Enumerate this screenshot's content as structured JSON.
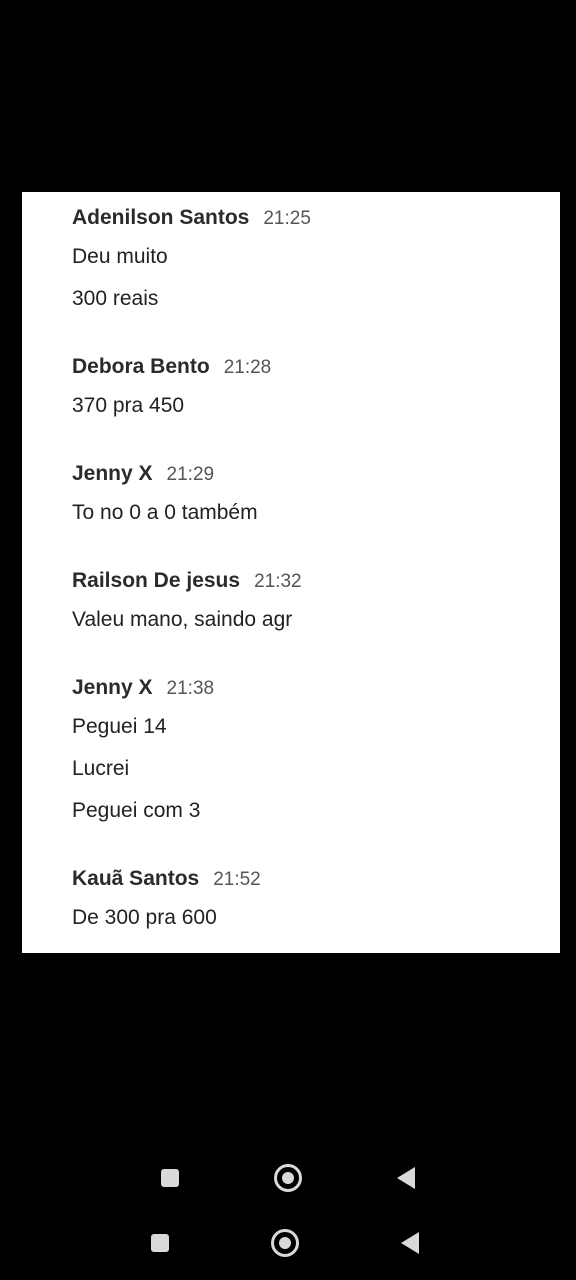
{
  "messages": [
    {
      "sender": "Adenilson Santos",
      "time": "21:25",
      "lines": [
        "Deu muito",
        "300 reais"
      ]
    },
    {
      "sender": "Debora Bento",
      "time": "21:28",
      "lines": [
        "370 pra 450"
      ]
    },
    {
      "sender": "Jenny X",
      "time": "21:29",
      "lines": [
        "To no 0 a 0 também"
      ]
    },
    {
      "sender": "Railson De jesus",
      "time": "21:32",
      "lines": [
        "Valeu mano, saindo agr"
      ]
    },
    {
      "sender": "Jenny X",
      "time": "21:38",
      "lines": [
        "Peguei 14",
        "Lucrei",
        "Peguei com 3"
      ]
    },
    {
      "sender": "Kauã Santos",
      "time": "21:52",
      "lines": [
        "De 300 pra 600"
      ]
    }
  ],
  "navbar": {
    "recents_icon": "square-icon",
    "home_icon": "circle-icon",
    "back_icon": "triangle-back-icon",
    "icon_color": "#d9d9d9"
  }
}
